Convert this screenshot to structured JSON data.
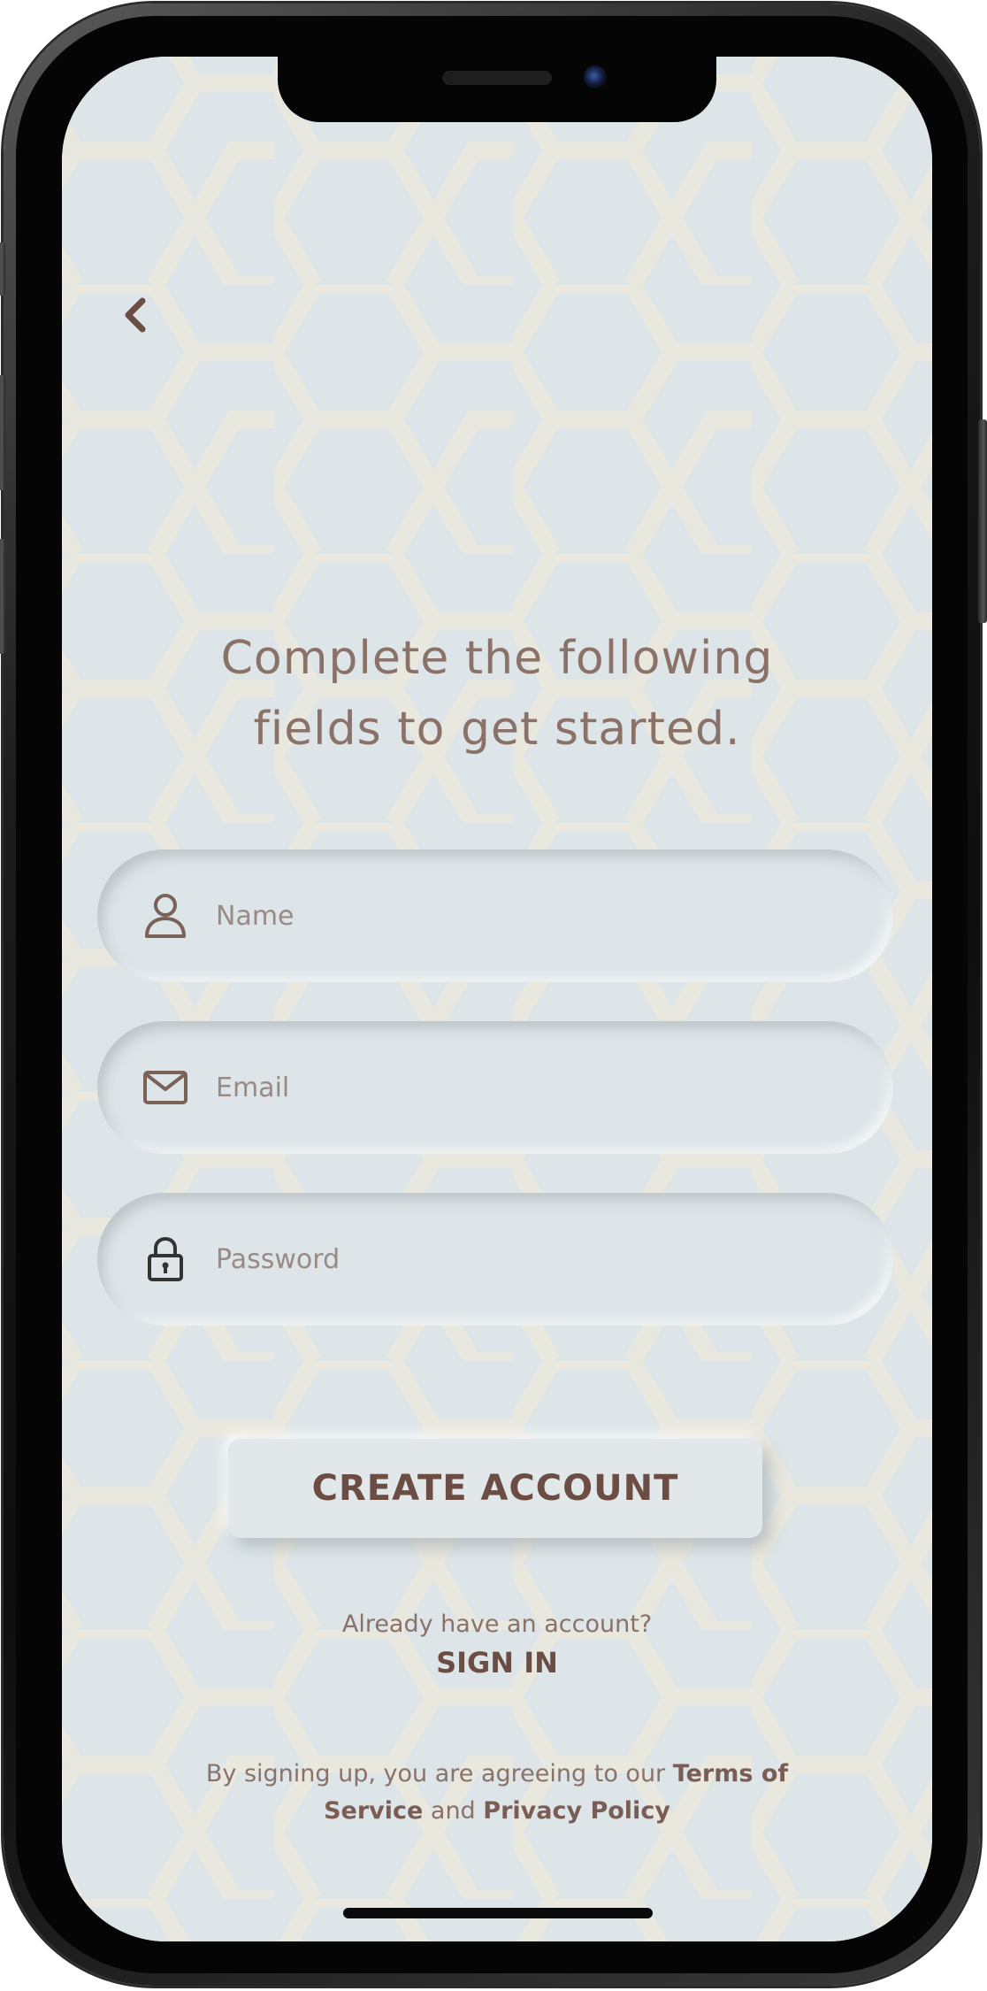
{
  "header": {
    "back_icon": "chevron-left-icon"
  },
  "headline": {
    "line1": "Complete the following",
    "line2": "fields to get started."
  },
  "form": {
    "name": {
      "placeholder": "Name",
      "value": "",
      "icon": "user-icon"
    },
    "email": {
      "placeholder": "Email",
      "value": "",
      "icon": "mail-icon"
    },
    "password": {
      "placeholder": "Password",
      "value": "",
      "icon": "lock-icon"
    }
  },
  "actions": {
    "create_account": "CREATE ACCOUNT",
    "already_text": "Already have an account?",
    "sign_in": "SIGN IN"
  },
  "legal": {
    "prefix": "By signing up, you are agreeing to our ",
    "terms_link": "Terms of Service",
    "conjunction": " and ",
    "privacy_link": "Privacy Policy"
  },
  "colors": {
    "background": "#dde5e8",
    "hex_pattern": "#ebe9dc",
    "primary_text": "#6b4d44",
    "secondary_text": "#8a7268"
  }
}
